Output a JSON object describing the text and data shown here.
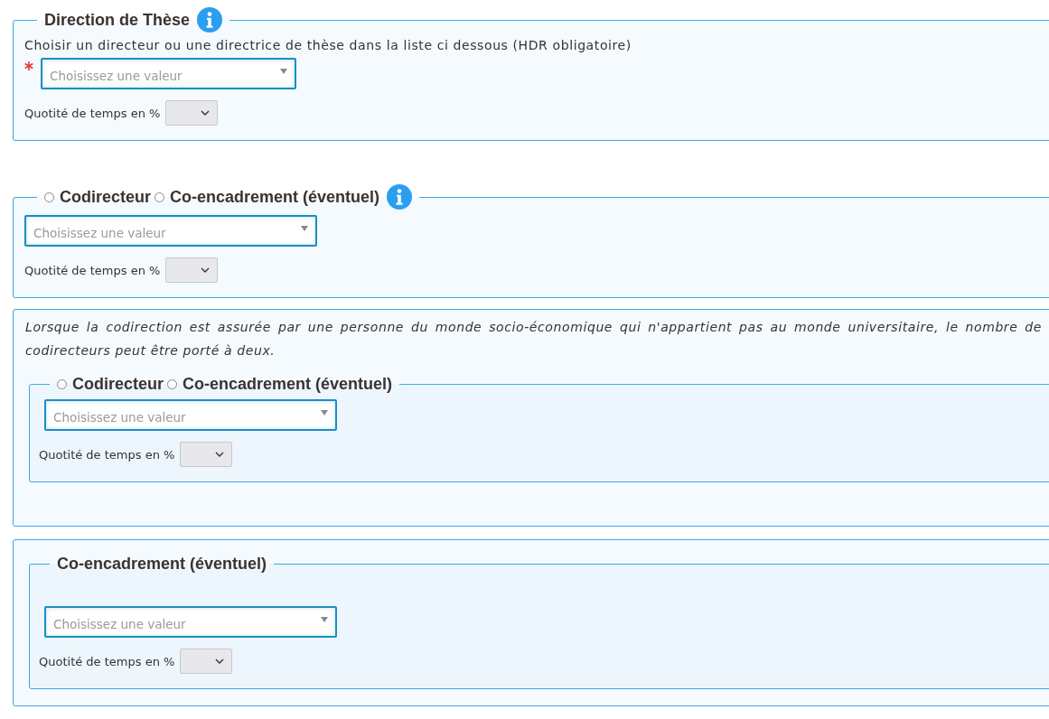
{
  "sections": [
    {
      "kind": "fieldset",
      "legend": [
        {
          "kind": "text",
          "label": "Direction de Thèse"
        }
      ],
      "info": true,
      "hint": "Choisir un directeur ou une directrice de thèse dans la liste ci dessous (HDR obligatoire)",
      "required": true,
      "select": {
        "placeholder": "Choisissez une valeur"
      },
      "quotite": {
        "label": "Quotité de temps en %"
      }
    },
    {
      "kind": "fieldset",
      "legend": [
        {
          "kind": "radio",
          "label": "Codirecteur",
          "selected": false
        },
        {
          "kind": "radio",
          "label": "Co-encadrement (éventuel)",
          "selected": false
        }
      ],
      "info": true,
      "required": false,
      "select": {
        "placeholder": "Choisissez une valeur"
      },
      "quotite": {
        "label": "Quotité de temps en %"
      }
    },
    {
      "kind": "box",
      "note": "Lorsque la codirection est assurée par une personne du monde socio-économique qui n'appartient pas au monde universitaire, le nombre de codirecteurs peut être porté à deux.",
      "inner": {
        "legend": [
          {
            "kind": "radio",
            "label": "Codirecteur",
            "selected": false
          },
          {
            "kind": "radio",
            "label": "Co-encadrement (éventuel)",
            "selected": false
          }
        ],
        "info": false,
        "required": false,
        "select": {
          "placeholder": "Choisissez une valeur"
        },
        "quotite": {
          "label": "Quotité de temps en %"
        }
      }
    },
    {
      "kind": "box",
      "inner": {
        "legend": [
          {
            "kind": "text",
            "label": "Co-encadrement (éventuel)"
          }
        ],
        "info": false,
        "required": false,
        "spaced": true,
        "select": {
          "placeholder": "Choisissez une valeur"
        },
        "quotite": {
          "label": "Quotité de temps en %"
        }
      }
    }
  ]
}
